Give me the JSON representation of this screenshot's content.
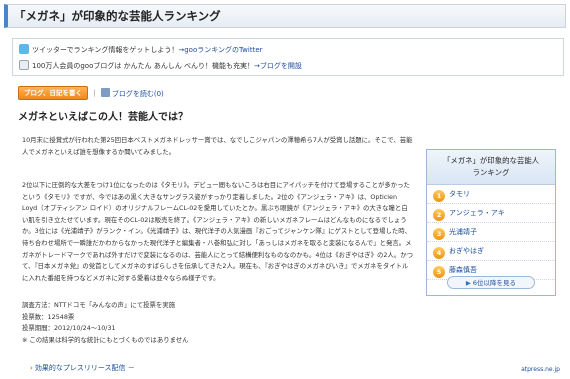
{
  "page": {
    "title": "「メガネ」が印象的な芸能人ランキング"
  },
  "promo": {
    "twitter_text": "ツイッターでランキング情報をゲットしよう！",
    "twitter_link": "→gooランキングのTwitter",
    "blog_text": "100万人会員のgooブログは かんたん あんしん べんり！機能も充実！",
    "blog_link": "→ブログを開設"
  },
  "actions": {
    "write_blog": "ブログ、日記を書く",
    "separator": "|",
    "read_blog": "ブログを読む",
    "read_count": "(0)"
  },
  "article": {
    "heading": "メガネといえばこの人！芸能人では？",
    "paragraph1": "10月末に授賞式が行われた第25回日本ベストメガネドレッサー賞では、なでしこジャパンの澤穂希ら7人が受賞し話題に。そこで、芸能人でメガネといえば誰を想像するか聞いてみました。",
    "paragraph2": "2位以下に圧倒的な大差をつけ1位になったのは《タモリ》。デビュー間もないころは右目にアイパッチを付けて登場することが多かったという《タモリ》ですが、今ではあの黒く大きなサングラス姿がすっかり定着しました。2位の《アンジェラ・アキ》は、Opticien Loyd（オプティシアン ロイド）のオリジナルフレームCL-02を愛用していたとか。黒ぶち眼鏡が《アンジェラ・アキ》の大きな瞳と白い肌を引き立たせています。現在そのCL-02は販売を終了。《アンジェラ・アキ》の新しいメガネフレームはどんなものになるでしょうか。3位には《光浦靖子》がランク・イン。《光浦靖子》は、現代洋子の人気漫画『おごってジャンケン隊』にゲストとして登場した時、待ち合わせ場所で一瞬誰だかわからなかった現代洋子と編集者・八巻和弘に対し「あっしはメガネを取ると変装になるんで」と発言。メガネがトレードマークであれば外すだけで変装になるのは、芸能人にとって結構便利なものなのかも。4位は《おぎやはぎ》の2人。かつて、『日本メガネ党』の党首としてメガネのすばらしさを伝承してきた2人。現在も、『おぎやはぎのメガネびいき』でメガネをタイトルに入れた番組を持つなどメガネに対する愛着は並々ならぬ様子です。",
    "meta": [
      "調査方法：NTTドコモ「みんなの声」にて投票を実施",
      "投票数：12548票",
      "投票期間：2012/10/24～10/31",
      "※ この結果は科学的な統計にもとづくものではありません"
    ]
  },
  "sidebar": {
    "heading_line1": "「メガネ」が印象的な芸能人",
    "heading_line2": "ランキング",
    "items": [
      {
        "rank": "1",
        "name": "タモリ"
      },
      {
        "rank": "2",
        "name": "アンジェラ・アキ"
      },
      {
        "rank": "3",
        "name": "光浦靖子"
      },
      {
        "rank": "4",
        "name": "おぎやはぎ"
      },
      {
        "rank": "5",
        "name": "藤森慎吾"
      }
    ],
    "more_label": "6位以降を見る",
    "more_icon": "play-icon"
  },
  "footer": {
    "press_link": "効果的なプレスリリース配信",
    "press_dash": "－",
    "credit": "atpress.ne.jp"
  },
  "colors": {
    "accent_blue": "#4a86c5",
    "link": "#1a4d99",
    "button_orange": "#f0861c"
  }
}
